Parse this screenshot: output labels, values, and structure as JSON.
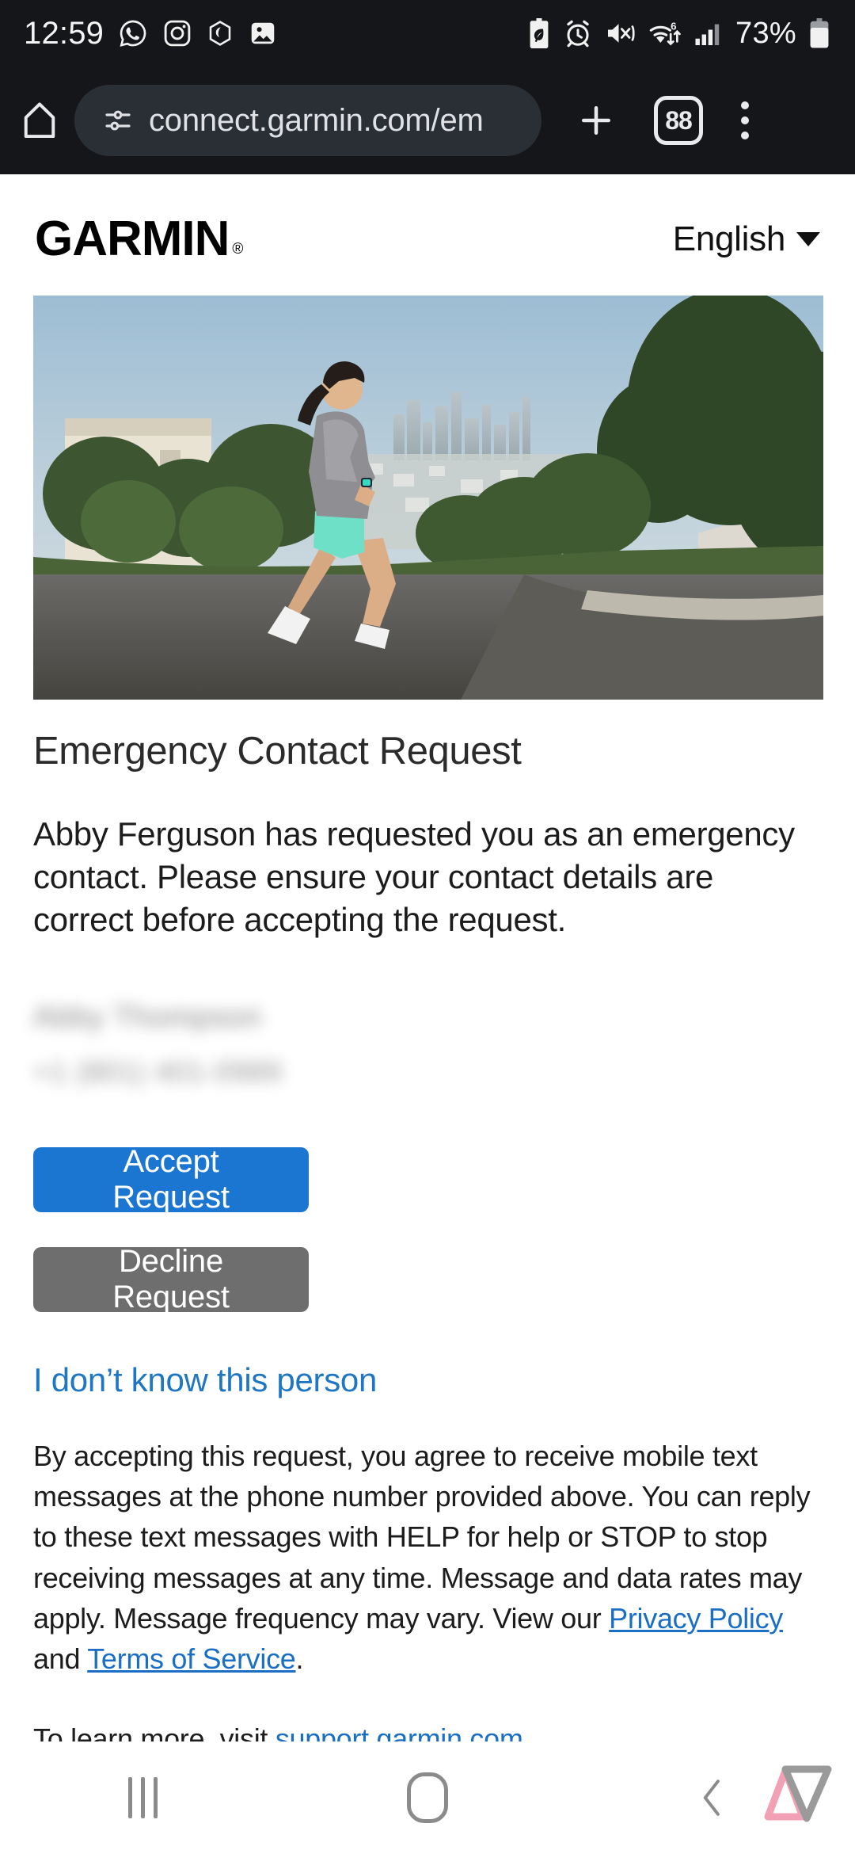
{
  "status_bar": {
    "clock": "12:59",
    "app_icons": [
      "whatsapp-icon",
      "instagram-icon",
      "hexagon-app-icon",
      "gallery-icon"
    ],
    "system_icons": [
      "battery-saver-icon",
      "alarm-icon",
      "mute-vibrate-icon",
      "wifi-6-icon",
      "cellular-signal-icon"
    ],
    "battery_percent": "73%"
  },
  "browser_bar": {
    "home_icon": "home-icon",
    "site_settings_icon": "tune-icon",
    "url": "connect.garmin.com/em",
    "new_tab_icon": "plus-icon",
    "tab_count": "88",
    "menu_icon": "kebab-menu-icon"
  },
  "page": {
    "brand": "GARMIN",
    "brand_mark": "®",
    "language": {
      "selected": "English",
      "caret_icon": "chevron-down-icon"
    },
    "hero_alt": "woman-running-hero-image",
    "heading": "Emergency Contact Request",
    "body": "Abby Ferguson has requested you as an emergency contact. Please ensure your contact details are correct before accepting the request.",
    "contact": {
      "name": "Abby Thompson",
      "phone": "+1 (801) 401-0989",
      "redacted": true
    },
    "accept_label": "Accept Request",
    "decline_label": "Decline Request",
    "unknown_person_link": "I don’t know this person",
    "legal": {
      "part1": "By accepting this request, you agree to receive mobile text messages at the phone number provided above. You can reply to these text messages with HELP for help or STOP to stop receiving messages at any time. Message and data rates may apply. Message frequency may vary. View our ",
      "privacy_link": "Privacy Policy",
      "mid": " and ",
      "terms_link": "Terms of Service",
      "end": "."
    },
    "learn_more": {
      "prefix": "To learn more, visit ",
      "link": "support.garmin.com",
      "suffix": "."
    },
    "colors": {
      "accept_blue": "#1b76d2",
      "decline_gray": "#6e6e6e",
      "link_blue": "#1f77c4",
      "heading_gray": "#2b2b2b"
    }
  },
  "nav_bar": {
    "recents_icon": "recent-apps-icon",
    "home_icon": "home-pill-icon",
    "back_icon": "back-chevron-icon",
    "watermark": "android-police-logo"
  }
}
